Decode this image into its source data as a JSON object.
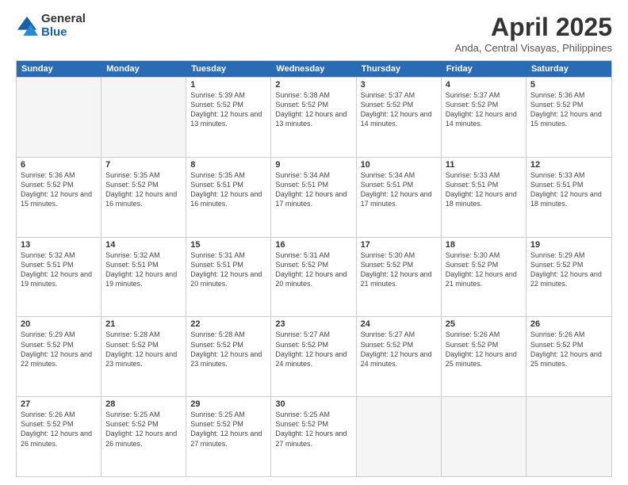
{
  "logo": {
    "general": "General",
    "blue": "Blue"
  },
  "title": "April 2025",
  "subtitle": "Anda, Central Visayas, Philippines",
  "days": [
    "Sunday",
    "Monday",
    "Tuesday",
    "Wednesday",
    "Thursday",
    "Friday",
    "Saturday"
  ],
  "weeks": [
    [
      {
        "day": null
      },
      {
        "day": null
      },
      {
        "day": 1,
        "sunrise": "5:39 AM",
        "sunset": "5:52 PM",
        "daylight": "12 hours and 13 minutes."
      },
      {
        "day": 2,
        "sunrise": "5:38 AM",
        "sunset": "5:52 PM",
        "daylight": "12 hours and 13 minutes."
      },
      {
        "day": 3,
        "sunrise": "5:37 AM",
        "sunset": "5:52 PM",
        "daylight": "12 hours and 14 minutes."
      },
      {
        "day": 4,
        "sunrise": "5:37 AM",
        "sunset": "5:52 PM",
        "daylight": "12 hours and 14 minutes."
      },
      {
        "day": 5,
        "sunrise": "5:36 AM",
        "sunset": "5:52 PM",
        "daylight": "12 hours and 15 minutes."
      }
    ],
    [
      {
        "day": 6,
        "sunrise": "5:36 AM",
        "sunset": "5:52 PM",
        "daylight": "12 hours and 15 minutes."
      },
      {
        "day": 7,
        "sunrise": "5:35 AM",
        "sunset": "5:52 PM",
        "daylight": "12 hours and 16 minutes."
      },
      {
        "day": 8,
        "sunrise": "5:35 AM",
        "sunset": "5:51 PM",
        "daylight": "12 hours and 16 minutes."
      },
      {
        "day": 9,
        "sunrise": "5:34 AM",
        "sunset": "5:51 PM",
        "daylight": "12 hours and 17 minutes."
      },
      {
        "day": 10,
        "sunrise": "5:34 AM",
        "sunset": "5:51 PM",
        "daylight": "12 hours and 17 minutes."
      },
      {
        "day": 11,
        "sunrise": "5:33 AM",
        "sunset": "5:51 PM",
        "daylight": "12 hours and 18 minutes."
      },
      {
        "day": 12,
        "sunrise": "5:33 AM",
        "sunset": "5:51 PM",
        "daylight": "12 hours and 18 minutes."
      }
    ],
    [
      {
        "day": 13,
        "sunrise": "5:32 AM",
        "sunset": "5:51 PM",
        "daylight": "12 hours and 19 minutes."
      },
      {
        "day": 14,
        "sunrise": "5:32 AM",
        "sunset": "5:51 PM",
        "daylight": "12 hours and 19 minutes."
      },
      {
        "day": 15,
        "sunrise": "5:31 AM",
        "sunset": "5:51 PM",
        "daylight": "12 hours and 20 minutes."
      },
      {
        "day": 16,
        "sunrise": "5:31 AM",
        "sunset": "5:52 PM",
        "daylight": "12 hours and 20 minutes."
      },
      {
        "day": 17,
        "sunrise": "5:30 AM",
        "sunset": "5:52 PM",
        "daylight": "12 hours and 21 minutes."
      },
      {
        "day": 18,
        "sunrise": "5:30 AM",
        "sunset": "5:52 PM",
        "daylight": "12 hours and 21 minutes."
      },
      {
        "day": 19,
        "sunrise": "5:29 AM",
        "sunset": "5:52 PM",
        "daylight": "12 hours and 22 minutes."
      }
    ],
    [
      {
        "day": 20,
        "sunrise": "5:29 AM",
        "sunset": "5:52 PM",
        "daylight": "12 hours and 22 minutes."
      },
      {
        "day": 21,
        "sunrise": "5:28 AM",
        "sunset": "5:52 PM",
        "daylight": "12 hours and 23 minutes."
      },
      {
        "day": 22,
        "sunrise": "5:28 AM",
        "sunset": "5:52 PM",
        "daylight": "12 hours and 23 minutes."
      },
      {
        "day": 23,
        "sunrise": "5:27 AM",
        "sunset": "5:52 PM",
        "daylight": "12 hours and 24 minutes."
      },
      {
        "day": 24,
        "sunrise": "5:27 AM",
        "sunset": "5:52 PM",
        "daylight": "12 hours and 24 minutes."
      },
      {
        "day": 25,
        "sunrise": "5:26 AM",
        "sunset": "5:52 PM",
        "daylight": "12 hours and 25 minutes."
      },
      {
        "day": 26,
        "sunrise": "5:26 AM",
        "sunset": "5:52 PM",
        "daylight": "12 hours and 25 minutes."
      }
    ],
    [
      {
        "day": 27,
        "sunrise": "5:26 AM",
        "sunset": "5:52 PM",
        "daylight": "12 hours and 26 minutes."
      },
      {
        "day": 28,
        "sunrise": "5:25 AM",
        "sunset": "5:52 PM",
        "daylight": "12 hours and 26 minutes."
      },
      {
        "day": 29,
        "sunrise": "5:25 AM",
        "sunset": "5:52 PM",
        "daylight": "12 hours and 27 minutes."
      },
      {
        "day": 30,
        "sunrise": "5:25 AM",
        "sunset": "5:52 PM",
        "daylight": "12 hours and 27 minutes."
      },
      {
        "day": null
      },
      {
        "day": null
      },
      {
        "day": null
      }
    ]
  ],
  "labels": {
    "sunrise": "Sunrise:",
    "sunset": "Sunset:",
    "daylight": "Daylight:"
  }
}
